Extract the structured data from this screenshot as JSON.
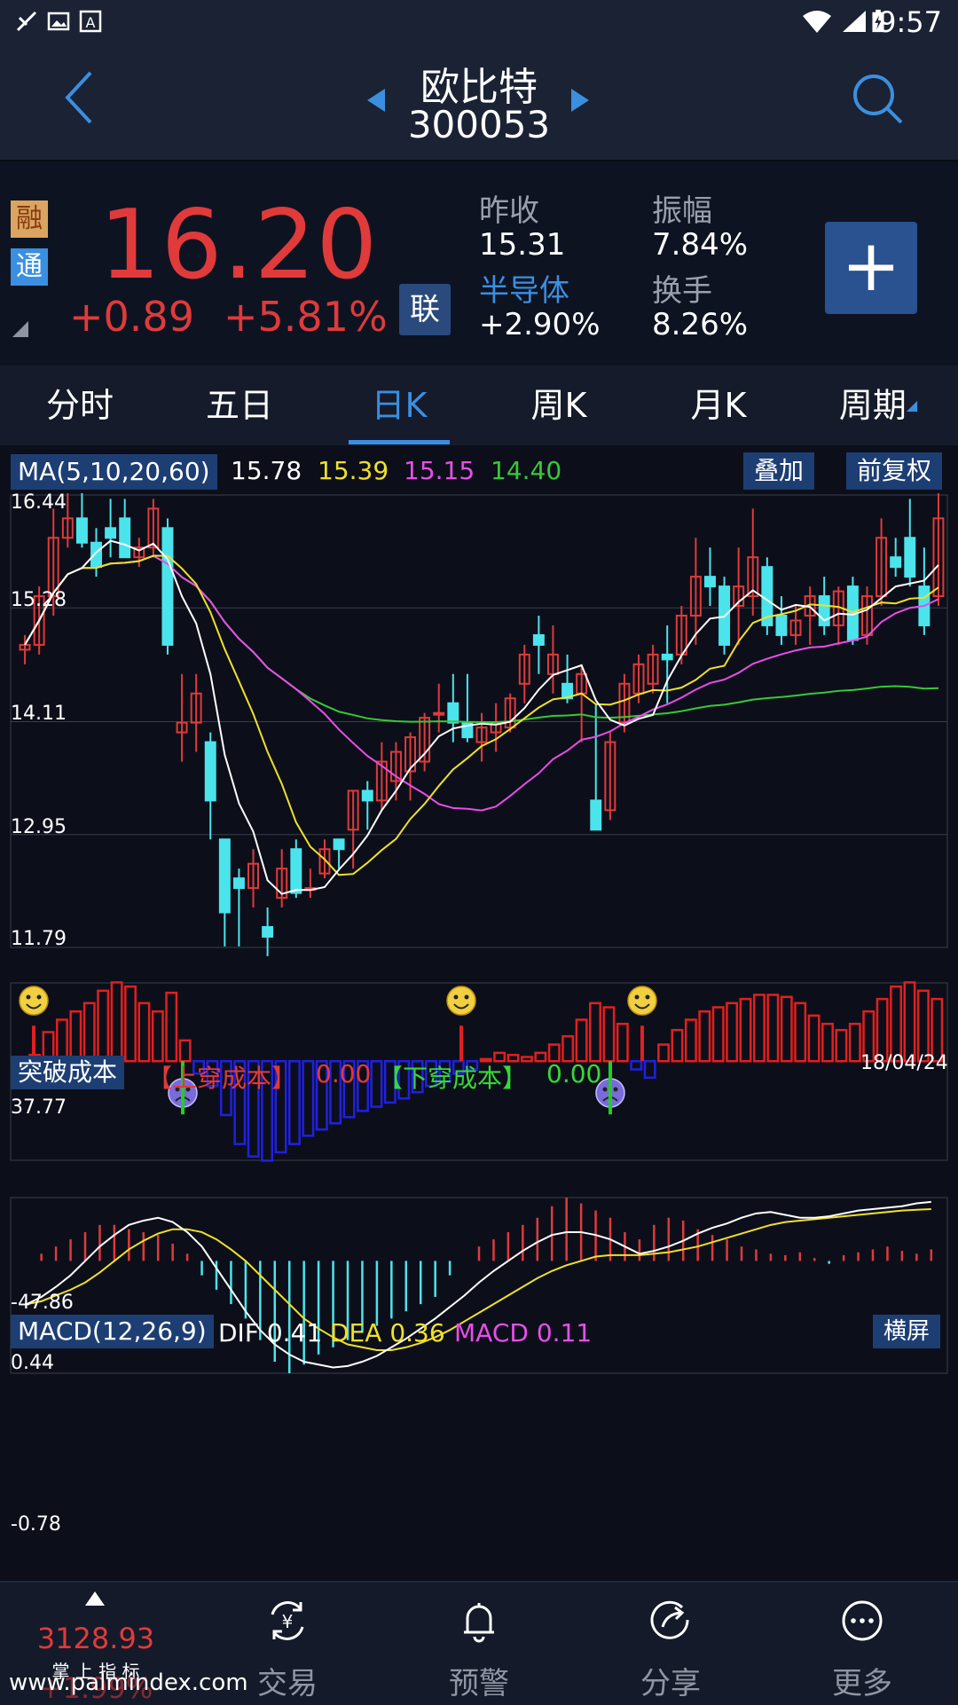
{
  "status_bar": {
    "time": "9:57"
  },
  "header": {
    "name": "欧比特",
    "code": "300053"
  },
  "quote": {
    "badge_rong": "融",
    "badge_tong": "通",
    "price": "16.20",
    "change": "+0.89",
    "change_pct": "+5.81%",
    "lian": "联",
    "prev_close_label": "昨收",
    "prev_close": "15.31",
    "amplitude_label": "振幅",
    "amplitude": "7.84%",
    "sector_label": "半导体",
    "sector_change": "+2.90%",
    "turnover_label": "换手",
    "turnover": "8.26%",
    "plus": "+"
  },
  "tabs": [
    {
      "label": "分时"
    },
    {
      "label": "五日"
    },
    {
      "label": "日K"
    },
    {
      "label": "周K"
    },
    {
      "label": "月K"
    },
    {
      "label": "周期"
    }
  ],
  "ma_panel": {
    "label": "MA(5,10,20,60)",
    "ma5": "15.78",
    "ma10": "15.39",
    "ma20": "15.15",
    "ma60": "14.40",
    "overlay_btn": "叠加",
    "adjust_btn": "前复权",
    "y_ticks": [
      "16.44",
      "15.28",
      "14.11",
      "12.95",
      "11.79"
    ]
  },
  "breakthrough_panel": {
    "label": "突破成本",
    "up_label": "【上穿成本】",
    "up_value": "0.00",
    "down_label": "【下穿成本】",
    "down_value": "0.00",
    "date": "18/04/24",
    "y_max": "37.77",
    "y_min": "-47.86"
  },
  "macd_panel": {
    "label": "MACD(12,26,9)",
    "dif_label": "DIF",
    "dif": "0.41",
    "dea_label": "DEA",
    "dea": "0.36",
    "macd_label": "MACD",
    "macd": "0.11",
    "landscape_btn": "横屏",
    "y_max": "0.44",
    "y_min": "-0.78"
  },
  "bottom_nav": {
    "index_value": "3128.93",
    "index_sub": "掌 上 指 标",
    "index_change": "+1.99%",
    "watermark": "www.palmindex.com",
    "items": [
      {
        "label": "交易"
      },
      {
        "label": "预警"
      },
      {
        "label": "分享"
      },
      {
        "label": "更多"
      }
    ]
  },
  "colors": {
    "up": "#e03a3a",
    "down": "#4be4ec",
    "accent": "#3b8fe0"
  },
  "chart_data": [
    {
      "type": "candlestick",
      "y_ticks": [
        16.44,
        15.28,
        14.11,
        12.95,
        11.79
      ],
      "ylim": [
        11.79,
        16.44
      ],
      "ohlc": [
        [
          14.85,
          15.0,
          14.7,
          14.9
        ],
        [
          14.9,
          15.5,
          14.8,
          15.4
        ],
        [
          15.4,
          16.3,
          15.2,
          16.0
        ],
        [
          16.0,
          16.5,
          15.9,
          16.2
        ],
        [
          16.2,
          16.5,
          15.9,
          15.95
        ],
        [
          15.95,
          16.1,
          15.6,
          15.7
        ],
        [
          16.1,
          16.4,
          15.8,
          16.0
        ],
        [
          16.2,
          16.4,
          15.9,
          15.8
        ],
        [
          15.8,
          16.0,
          15.7,
          15.9
        ],
        [
          15.9,
          16.4,
          15.8,
          16.3
        ],
        [
          16.1,
          16.2,
          14.8,
          14.9
        ],
        [
          14.0,
          14.6,
          13.7,
          14.1
        ],
        [
          14.1,
          14.6,
          13.8,
          14.4
        ],
        [
          13.9,
          14.0,
          12.9,
          13.3
        ],
        [
          12.9,
          12.9,
          11.8,
          12.15
        ],
        [
          12.5,
          12.6,
          11.8,
          12.4
        ],
        [
          12.4,
          12.8,
          12.2,
          12.65
        ],
        [
          12.0,
          12.2,
          11.7,
          11.9
        ],
        [
          12.3,
          12.8,
          12.2,
          12.6
        ],
        [
          12.8,
          12.9,
          12.3,
          12.35
        ],
        [
          12.4,
          12.6,
          12.3,
          12.4
        ],
        [
          12.55,
          12.9,
          12.5,
          12.8
        ],
        [
          12.9,
          12.9,
          12.6,
          12.8
        ],
        [
          13.0,
          13.4,
          12.6,
          13.4
        ],
        [
          13.4,
          13.5,
          13.0,
          13.3
        ],
        [
          13.3,
          13.9,
          13.2,
          13.7
        ],
        [
          13.5,
          13.9,
          13.3,
          13.8
        ],
        [
          13.6,
          14.0,
          13.3,
          13.95
        ],
        [
          13.7,
          14.2,
          13.6,
          14.15
        ],
        [
          14.2,
          14.5,
          14.0,
          14.2
        ],
        [
          14.3,
          14.6,
          13.9,
          14.1
        ],
        [
          14.1,
          14.6,
          13.9,
          13.95
        ],
        [
          13.9,
          14.2,
          13.7,
          14.05
        ],
        [
          14.0,
          14.3,
          13.8,
          14.1
        ],
        [
          14.05,
          14.4,
          14.0,
          14.35
        ],
        [
          14.5,
          14.9,
          14.3,
          14.8
        ],
        [
          15.0,
          15.2,
          14.6,
          14.9
        ],
        [
          14.6,
          15.1,
          14.4,
          14.8
        ],
        [
          14.5,
          14.8,
          14.3,
          14.35
        ],
        [
          14.4,
          14.7,
          13.9,
          14.6
        ],
        [
          13.3,
          14.3,
          13.0,
          13.0
        ],
        [
          13.2,
          14.0,
          13.1,
          13.9
        ],
        [
          14.1,
          14.6,
          14.0,
          14.5
        ],
        [
          14.4,
          14.8,
          14.3,
          14.7
        ],
        [
          14.5,
          14.9,
          14.4,
          14.8
        ],
        [
          14.8,
          15.1,
          14.3,
          14.75
        ],
        [
          14.8,
          15.3,
          14.7,
          15.2
        ],
        [
          15.2,
          16.0,
          14.9,
          15.6
        ],
        [
          15.6,
          15.9,
          15.3,
          15.5
        ],
        [
          15.5,
          15.6,
          14.8,
          14.9
        ],
        [
          15.3,
          15.9,
          14.9,
          15.5
        ],
        [
          15.4,
          16.3,
          15.2,
          15.8
        ],
        [
          15.7,
          15.8,
          15.0,
          15.1
        ],
        [
          15.2,
          15.4,
          14.9,
          15.0
        ],
        [
          15.0,
          15.3,
          14.9,
          15.15
        ],
        [
          15.2,
          15.5,
          14.9,
          15.4
        ],
        [
          15.4,
          15.6,
          15.0,
          15.1
        ],
        [
          15.1,
          15.5,
          14.9,
          15.45
        ],
        [
          15.5,
          15.6,
          14.9,
          14.95
        ],
        [
          15.0,
          15.5,
          14.9,
          15.4
        ],
        [
          15.4,
          16.2,
          15.3,
          16.0
        ],
        [
          15.8,
          16.0,
          15.6,
          15.7
        ],
        [
          16.0,
          16.4,
          15.5,
          15.6
        ],
        [
          15.5,
          15.9,
          15.0,
          15.1
        ],
        [
          15.4,
          16.5,
          15.3,
          16.2
        ]
      ]
    },
    {
      "type": "bar",
      "title": "突破成本",
      "ylim": [
        -47.86,
        37.77
      ],
      "values": [
        -8,
        3,
        14,
        20,
        24,
        28,
        34,
        38,
        36,
        28,
        24,
        33,
        10,
        -6,
        -12,
        -26,
        -40,
        -46,
        -48,
        -44,
        -40,
        -36,
        -33,
        -30,
        -27,
        -24,
        -22,
        -20,
        -18,
        -15,
        -12,
        -10,
        -6,
        -4,
        1,
        4,
        3,
        2,
        4,
        8,
        12,
        20,
        28,
        26,
        18,
        -4,
        -8,
        8,
        15,
        20,
        24,
        26,
        28,
        30,
        32,
        32,
        31,
        28,
        22,
        18,
        15,
        18,
        24,
        30,
        36,
        38,
        34,
        30
      ]
    },
    {
      "type": "bar",
      "title": "MACD(12,26,9)",
      "ylim": [
        -0.78,
        0.44
      ],
      "series": [
        {
          "name": "MACD",
          "values": [
            0.0,
            0.05,
            0.1,
            0.15,
            0.2,
            0.25,
            0.25,
            0.22,
            0.2,
            0.18,
            0.12,
            0.05,
            -0.1,
            -0.2,
            -0.3,
            -0.4,
            -0.55,
            -0.7,
            -0.78,
            -0.72,
            -0.65,
            -0.6,
            -0.55,
            -0.5,
            -0.45,
            -0.4,
            -0.35,
            -0.3,
            -0.25,
            -0.1,
            0.0,
            0.1,
            0.15,
            0.2,
            0.25,
            0.3,
            0.38,
            0.44,
            0.4,
            0.35,
            0.3,
            0.2,
            0.15,
            0.25,
            0.3,
            0.28,
            0.22,
            0.18,
            0.15,
            0.1,
            0.08,
            0.05,
            0.04,
            0.06,
            0.02,
            -0.02,
            0.04,
            0.06,
            0.08,
            0.1,
            0.07,
            0.05,
            0.08
          ]
        },
        {
          "name": "DIF",
          "values": [
            -0.3,
            -0.25,
            -0.18,
            -0.1,
            0.0,
            0.1,
            0.18,
            0.25,
            0.28,
            0.3,
            0.27,
            0.2,
            0.1,
            -0.05,
            -0.2,
            -0.35,
            -0.48,
            -0.58,
            -0.65,
            -0.7,
            -0.72,
            -0.74,
            -0.73,
            -0.7,
            -0.66,
            -0.6,
            -0.54,
            -0.47,
            -0.4,
            -0.32,
            -0.24,
            -0.15,
            -0.07,
            0.0,
            0.07,
            0.13,
            0.18,
            0.2,
            0.2,
            0.18,
            0.15,
            0.1,
            0.05,
            0.07,
            0.1,
            0.14,
            0.19,
            0.23,
            0.26,
            0.3,
            0.33,
            0.34,
            0.32,
            0.3,
            0.3,
            0.31,
            0.33,
            0.35,
            0.36,
            0.37,
            0.38,
            0.4,
            0.41
          ]
        },
        {
          "name": "DEA",
          "values": [
            -0.3,
            -0.28,
            -0.24,
            -0.2,
            -0.15,
            -0.08,
            0.0,
            0.08,
            0.14,
            0.19,
            0.22,
            0.22,
            0.2,
            0.15,
            0.08,
            0.0,
            -0.1,
            -0.2,
            -0.3,
            -0.4,
            -0.47,
            -0.53,
            -0.58,
            -0.6,
            -0.62,
            -0.62,
            -0.6,
            -0.57,
            -0.53,
            -0.48,
            -0.42,
            -0.36,
            -0.3,
            -0.24,
            -0.18,
            -0.12,
            -0.07,
            -0.03,
            0.0,
            0.03,
            0.04,
            0.04,
            0.04,
            0.05,
            0.06,
            0.08,
            0.1,
            0.13,
            0.16,
            0.19,
            0.22,
            0.25,
            0.27,
            0.28,
            0.29,
            0.3,
            0.31,
            0.32,
            0.33,
            0.34,
            0.35,
            0.355,
            0.36
          ]
        }
      ]
    }
  ]
}
